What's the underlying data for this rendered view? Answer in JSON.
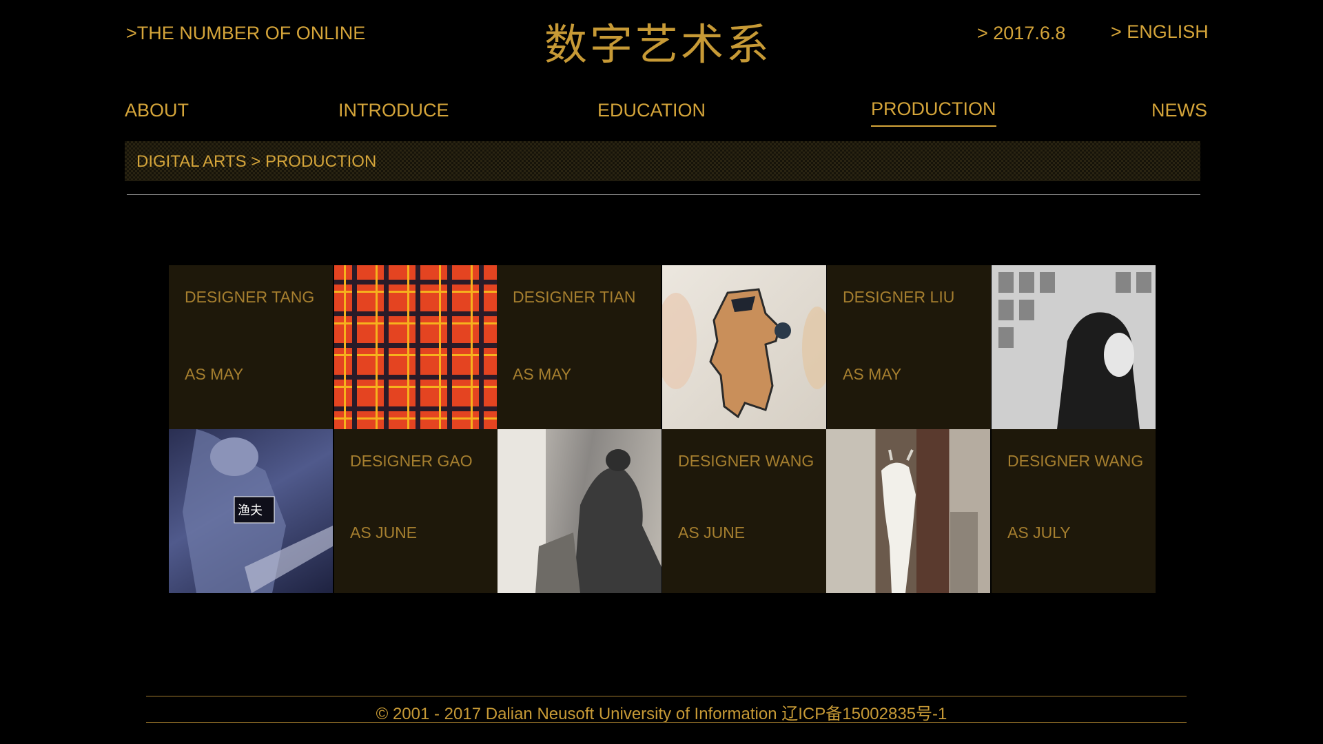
{
  "header": {
    "online_label": ">THE NUMBER OF ONLINE",
    "site_title": "数字艺术系",
    "date": ">  2017.6.8",
    "language": ">  ENGLISH"
  },
  "nav": {
    "items": [
      "ABOUT",
      "INTRODUCE",
      "EDUCATION",
      "PRODUCTION",
      "NEWS"
    ],
    "active": "PRODUCTION"
  },
  "breadcrumb": "DIGITAL ARTS > PRODUCTION",
  "works": [
    {
      "designer": "DESIGNER TANG",
      "month": "AS MAY",
      "image": "plaid-fabric-image"
    },
    {
      "designer": "DESIGNER TIAN",
      "month": "AS MAY",
      "image": "ceramic-figure-image"
    },
    {
      "designer": "DESIGNER LIU",
      "month": "AS MAY",
      "image": "woman-portrait-image"
    },
    {
      "designer": "DESIGNER GAO",
      "month": "AS JUNE",
      "image": "fisherman-image"
    },
    {
      "designer": "DESIGNER WANG",
      "month": "AS JUNE",
      "image": "old-man-photo-image"
    },
    {
      "designer": "DESIGNER WANG",
      "month": "AS JULY",
      "image": "goat-photo-image"
    }
  ],
  "overlay_text": "渔夫",
  "footer": "© 2001 - 2017 Dalian Neusoft University of Information   辽ICP备15002835号-1",
  "colors": {
    "accent": "#d5a53a",
    "card_bg": "#1e180a",
    "card_text": "#a67f2f",
    "background": "#000000"
  }
}
